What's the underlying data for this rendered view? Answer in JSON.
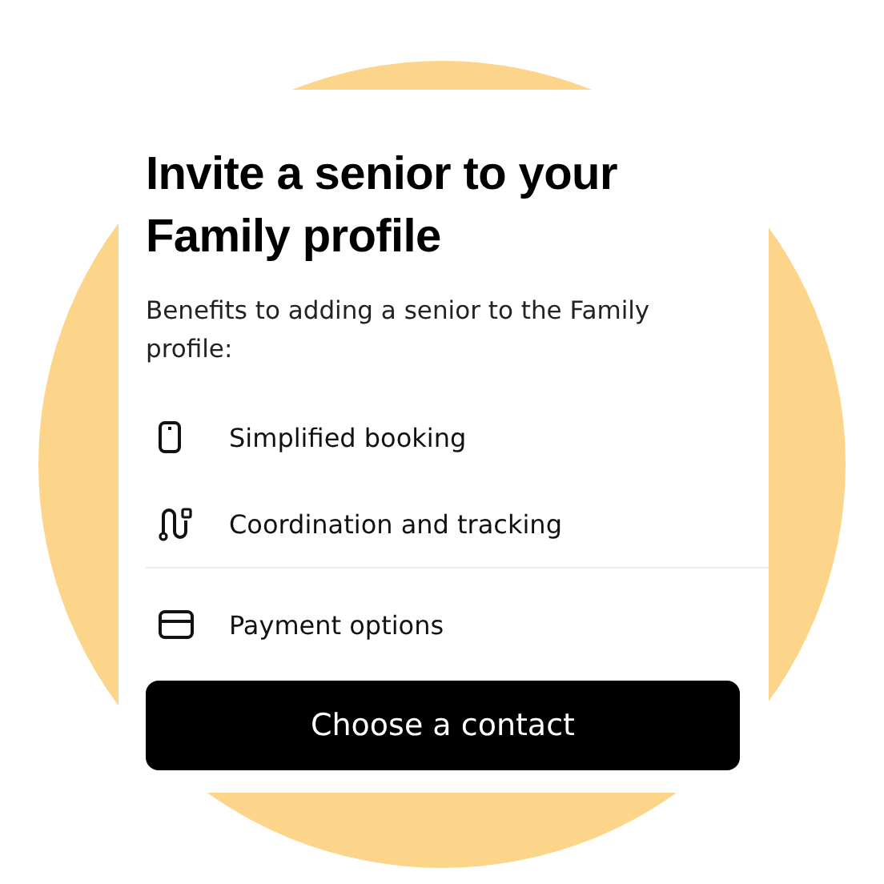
{
  "card": {
    "title": "Invite a senior to your Family profile",
    "subtitle": "Benefits to adding a senior to the Family profile:",
    "benefits": [
      {
        "kind": "phone",
        "label": "Simplified booking",
        "divider_below": false
      },
      {
        "kind": "route",
        "label": "Coordination and tracking",
        "divider_below": true
      },
      {
        "kind": "card",
        "label": "Payment options",
        "divider_below": false
      }
    ],
    "button": "Choose a contact"
  }
}
